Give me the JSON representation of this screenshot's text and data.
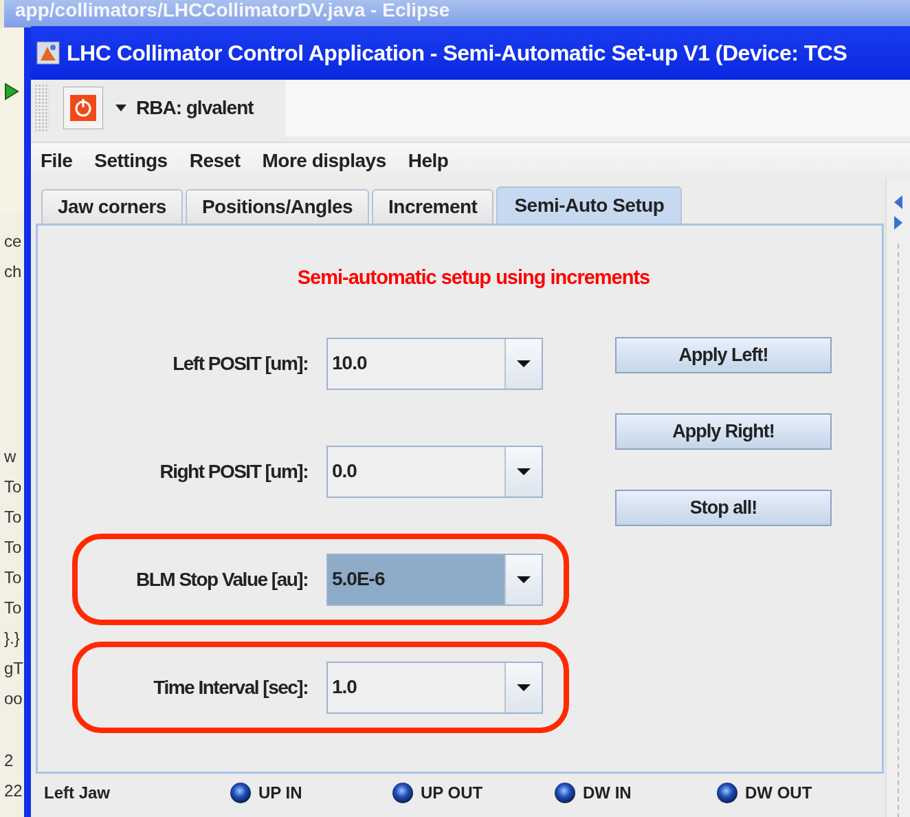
{
  "background_window": {
    "title": "app/collimators/LHCCollimatorDV.java - Eclipse",
    "edge_texts": [
      "ce",
      "ch",
      "w",
      "To",
      "To",
      "To",
      "To",
      "To",
      "}.}",
      "gT",
      "oo",
      "2",
      "22"
    ]
  },
  "window": {
    "title": "LHC Collimator Control Application - Semi-Automatic Set-up V1 (Device: TCS"
  },
  "toolbar": {
    "user": "RBA: glvalent"
  },
  "menu": [
    "File",
    "Settings",
    "Reset",
    "More displays",
    "Help"
  ],
  "tabs": [
    {
      "label": "Jaw corners",
      "selected": false
    },
    {
      "label": "Positions/Angles",
      "selected": false
    },
    {
      "label": "Increment",
      "selected": false
    },
    {
      "label": "Semi-Auto Setup",
      "selected": true
    }
  ],
  "panel": {
    "heading": "Semi-automatic setup using increments",
    "fields": [
      {
        "label": "Left POSIT [um]:",
        "value": "10.0",
        "highlighted": false,
        "focused": false
      },
      {
        "label": "Right POSIT [um]:",
        "value": "0.0",
        "highlighted": false,
        "focused": false
      },
      {
        "label": "BLM Stop Value [au]:",
        "value": "5.0E-6",
        "highlighted": true,
        "focused": true
      },
      {
        "label": "Time Interval [sec]:",
        "value": "1.0",
        "highlighted": true,
        "focused": false
      }
    ],
    "buttons": [
      "Apply Left!",
      "Apply Right!",
      "Stop all!"
    ]
  },
  "jaw_row": {
    "label": "Left Jaw",
    "controls": [
      "UP IN",
      "UP OUT",
      "DW IN",
      "DW OUT"
    ]
  }
}
